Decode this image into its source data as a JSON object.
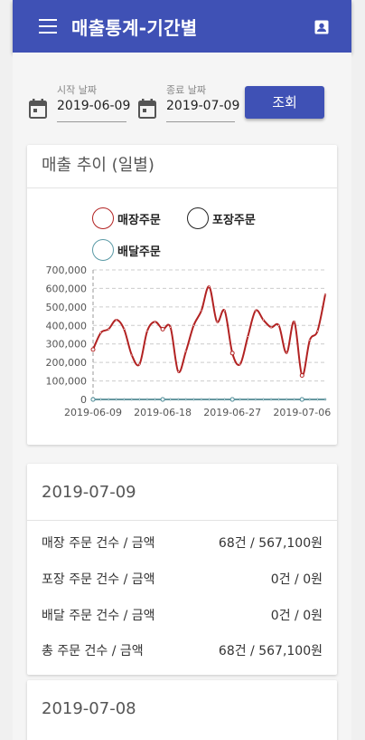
{
  "app_bar": {
    "title": "매출통계-기간별",
    "menu_icon": "menu-icon",
    "account_icon": "account-box-icon",
    "color": "#3f51b5"
  },
  "filters": {
    "start_label": "시작 날짜",
    "start_value": "2019-06-09",
    "end_label": "종료 날짜",
    "end_value": "2019-07-09",
    "search_label": "조회"
  },
  "chart_card": {
    "title": "매출 추이 (일별)"
  },
  "chart_data": {
    "type": "line",
    "legend": [
      "매장주문",
      "포장주문",
      "배달주문"
    ],
    "x_tick_labels": [
      "2019-06-09",
      "2019-06-18",
      "2019-06-27",
      "2019-07-06"
    ],
    "y_tick_labels": [
      "0",
      "100,000",
      "200,000",
      "300,000",
      "400,000",
      "500,000",
      "600,000",
      "700,000"
    ],
    "ylim": [
      0,
      700000
    ],
    "x": [
      "2019-06-09",
      "2019-06-10",
      "2019-06-11",
      "2019-06-12",
      "2019-06-13",
      "2019-06-14",
      "2019-06-15",
      "2019-06-16",
      "2019-06-17",
      "2019-06-18",
      "2019-06-19",
      "2019-06-20",
      "2019-06-21",
      "2019-06-22",
      "2019-06-23",
      "2019-06-24",
      "2019-06-25",
      "2019-06-26",
      "2019-06-27",
      "2019-06-28",
      "2019-06-29",
      "2019-06-30",
      "2019-07-01",
      "2019-07-02",
      "2019-07-03",
      "2019-07-04",
      "2019-07-05",
      "2019-07-06",
      "2019-07-07",
      "2019-07-08",
      "2019-07-09"
    ],
    "series": [
      {
        "name": "매장주문",
        "color": "#b22222",
        "values": [
          270000,
          360000,
          380000,
          430000,
          380000,
          240000,
          190000,
          370000,
          420000,
          380000,
          390000,
          150000,
          260000,
          400000,
          480000,
          610000,
          420000,
          480000,
          250000,
          190000,
          340000,
          480000,
          430000,
          390000,
          400000,
          250000,
          420000,
          130000,
          320000,
          370000,
          567100
        ]
      },
      {
        "name": "포장주문",
        "color": "#222222",
        "values": [
          0,
          0,
          0,
          0,
          0,
          0,
          0,
          0,
          0,
          0,
          0,
          0,
          0,
          0,
          0,
          0,
          0,
          0,
          0,
          0,
          0,
          0,
          0,
          0,
          0,
          0,
          0,
          0,
          0,
          0,
          0
        ]
      },
      {
        "name": "배달주문",
        "color": "#5a9aa6",
        "values": [
          0,
          0,
          0,
          0,
          0,
          0,
          0,
          0,
          0,
          0,
          0,
          0,
          0,
          0,
          0,
          0,
          0,
          0,
          0,
          0,
          0,
          0,
          0,
          0,
          0,
          0,
          0,
          0,
          0,
          0,
          0
        ]
      }
    ],
    "grid": "dashed horizontal"
  },
  "summary": [
    {
      "date": "2019-07-09",
      "rows": [
        {
          "label": "매장 주문 건수 / 금액",
          "value": "68건 / 567,100원"
        },
        {
          "label": "포장 주문 건수 / 금액",
          "value": "0건 / 0원"
        },
        {
          "label": "배달 주문 건수 / 금액",
          "value": "0건 / 0원"
        },
        {
          "label": "총 주문 건수 / 금액",
          "value": "68건 / 567,100원"
        }
      ]
    },
    {
      "date": "2019-07-08"
    }
  ]
}
